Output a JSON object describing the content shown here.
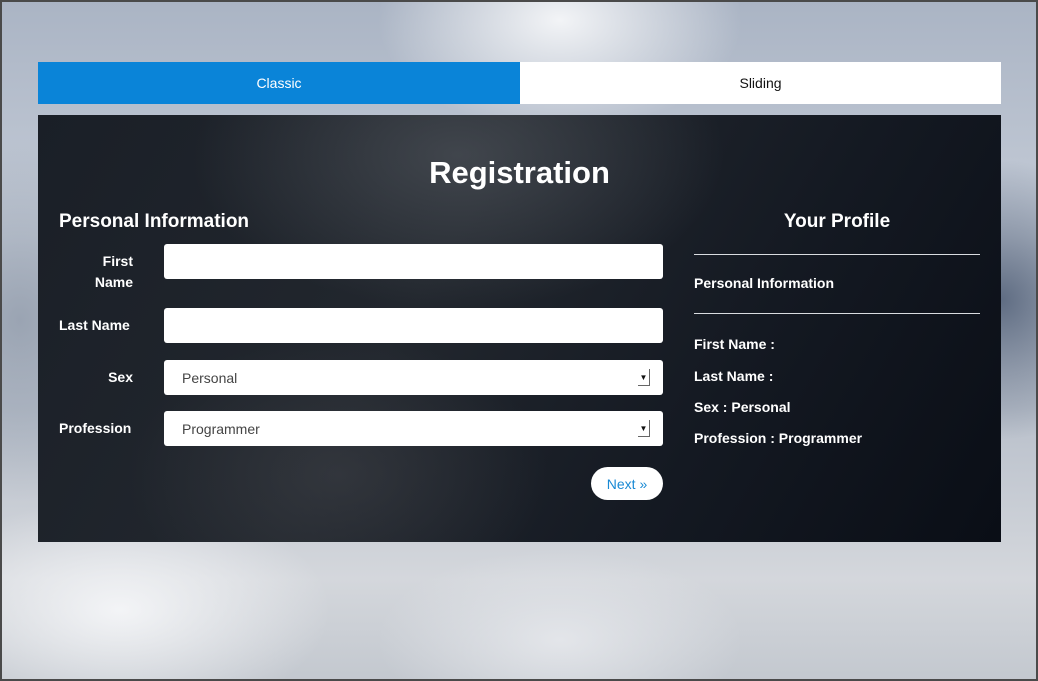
{
  "tabs": [
    {
      "label": "Classic",
      "active": true
    },
    {
      "label": "Sliding",
      "active": false
    }
  ],
  "colors": {
    "active_tab": "#0a84d8",
    "next_text": "#1a8ad4"
  },
  "form": {
    "title": "Registration",
    "section_title": "Personal Information",
    "first_name": {
      "label_line1": "First",
      "label_line2": "Name",
      "value": ""
    },
    "last_name": {
      "label": "Last Name",
      "value": ""
    },
    "sex": {
      "label": "Sex",
      "selected": "Personal"
    },
    "profession": {
      "label": "Profession",
      "selected": "Programmer"
    },
    "next_label": "Next »"
  },
  "profile": {
    "title": "Your Profile",
    "section": "Personal Information",
    "first_name": "First Name :",
    "last_name": "Last Name :",
    "sex": "Sex : Personal",
    "profession": "Profession : Programmer"
  },
  "icons": {
    "select_arrow": "dropdown-arrow-icon"
  }
}
